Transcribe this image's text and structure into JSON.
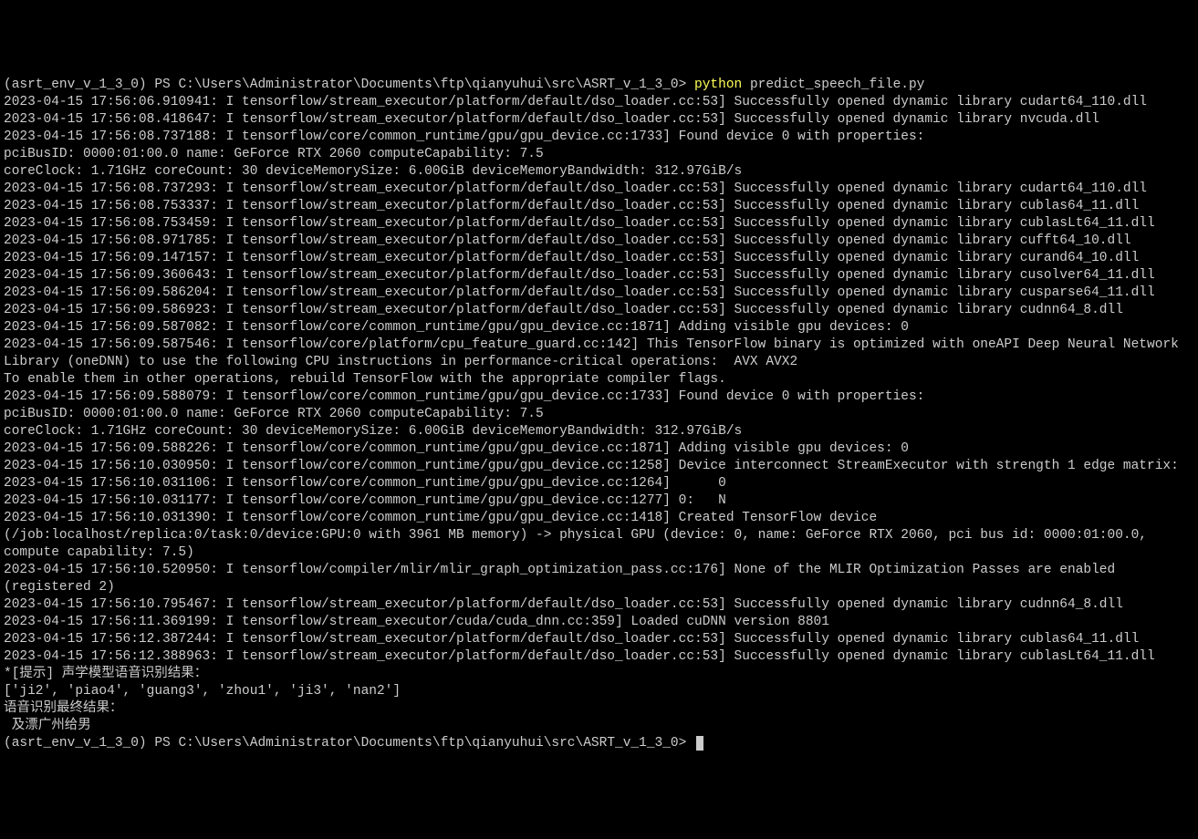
{
  "prompt1": {
    "env": "(asrt_env_v_1_3_0) ",
    "ps": "PS ",
    "path": "C:\\Users\\Administrator\\Documents\\ftp\\qianyuhui\\src\\ASRT_v_1_3_0> ",
    "cmd": "python",
    "arg": " predict_speech_file.py"
  },
  "logs": [
    "2023-04-15 17:56:06.910941: I tensorflow/stream_executor/platform/default/dso_loader.cc:53] Successfully opened dynamic library cudart64_110.dll",
    "2023-04-15 17:56:08.418647: I tensorflow/stream_executor/platform/default/dso_loader.cc:53] Successfully opened dynamic library nvcuda.dll",
    "2023-04-15 17:56:08.737188: I tensorflow/core/common_runtime/gpu/gpu_device.cc:1733] Found device 0 with properties:",
    "pciBusID: 0000:01:00.0 name: GeForce RTX 2060 computeCapability: 7.5",
    "coreClock: 1.71GHz coreCount: 30 deviceMemorySize: 6.00GiB deviceMemoryBandwidth: 312.97GiB/s",
    "2023-04-15 17:56:08.737293: I tensorflow/stream_executor/platform/default/dso_loader.cc:53] Successfully opened dynamic library cudart64_110.dll",
    "2023-04-15 17:56:08.753337: I tensorflow/stream_executor/platform/default/dso_loader.cc:53] Successfully opened dynamic library cublas64_11.dll",
    "2023-04-15 17:56:08.753459: I tensorflow/stream_executor/platform/default/dso_loader.cc:53] Successfully opened dynamic library cublasLt64_11.dll",
    "2023-04-15 17:56:08.971785: I tensorflow/stream_executor/platform/default/dso_loader.cc:53] Successfully opened dynamic library cufft64_10.dll",
    "2023-04-15 17:56:09.147157: I tensorflow/stream_executor/platform/default/dso_loader.cc:53] Successfully opened dynamic library curand64_10.dll",
    "2023-04-15 17:56:09.360643: I tensorflow/stream_executor/platform/default/dso_loader.cc:53] Successfully opened dynamic library cusolver64_11.dll",
    "2023-04-15 17:56:09.586204: I tensorflow/stream_executor/platform/default/dso_loader.cc:53] Successfully opened dynamic library cusparse64_11.dll",
    "2023-04-15 17:56:09.586923: I tensorflow/stream_executor/platform/default/dso_loader.cc:53] Successfully opened dynamic library cudnn64_8.dll",
    "2023-04-15 17:56:09.587082: I tensorflow/core/common_runtime/gpu/gpu_device.cc:1871] Adding visible gpu devices: 0",
    "2023-04-15 17:56:09.587546: I tensorflow/core/platform/cpu_feature_guard.cc:142] This TensorFlow binary is optimized with oneAPI Deep Neural Network Library (oneDNN) to use the following CPU instructions in performance-critical operations:  AVX AVX2",
    "To enable them in other operations, rebuild TensorFlow with the appropriate compiler flags.",
    "2023-04-15 17:56:09.588079: I tensorflow/core/common_runtime/gpu/gpu_device.cc:1733] Found device 0 with properties:",
    "pciBusID: 0000:01:00.0 name: GeForce RTX 2060 computeCapability: 7.5",
    "coreClock: 1.71GHz coreCount: 30 deviceMemorySize: 6.00GiB deviceMemoryBandwidth: 312.97GiB/s",
    "2023-04-15 17:56:09.588226: I tensorflow/core/common_runtime/gpu/gpu_device.cc:1871] Adding visible gpu devices: 0",
    "2023-04-15 17:56:10.030950: I tensorflow/core/common_runtime/gpu/gpu_device.cc:1258] Device interconnect StreamExecutor with strength 1 edge matrix:",
    "2023-04-15 17:56:10.031106: I tensorflow/core/common_runtime/gpu/gpu_device.cc:1264]      0",
    "2023-04-15 17:56:10.031177: I tensorflow/core/common_runtime/gpu/gpu_device.cc:1277] 0:   N",
    "2023-04-15 17:56:10.031390: I tensorflow/core/common_runtime/gpu/gpu_device.cc:1418] Created TensorFlow device (/job:localhost/replica:0/task:0/device:GPU:0 with 3961 MB memory) -> physical GPU (device: 0, name: GeForce RTX 2060, pci bus id: 0000:01:00.0, compute capability: 7.5)",
    "2023-04-15 17:56:10.520950: I tensorflow/compiler/mlir/mlir_graph_optimization_pass.cc:176] None of the MLIR Optimization Passes are enabled (registered 2)",
    "2023-04-15 17:56:10.795467: I tensorflow/stream_executor/platform/default/dso_loader.cc:53] Successfully opened dynamic library cudnn64_8.dll",
    "2023-04-15 17:56:11.369199: I tensorflow/stream_executor/cuda/cuda_dnn.cc:359] Loaded cuDNN version 8801",
    "2023-04-15 17:56:12.387244: I tensorflow/stream_executor/platform/default/dso_loader.cc:53] Successfully opened dynamic library cublas64_11.dll",
    "2023-04-15 17:56:12.388963: I tensorflow/stream_executor/platform/default/dso_loader.cc:53] Successfully opened dynamic library cublasLt64_11.dll",
    "*[提示] 声学模型语音识别结果：",
    "['ji2', 'piao4', 'guang3', 'zhou1', 'ji3', 'nan2']",
    "语音识别最终结果：",
    " 及漂广州给男"
  ],
  "prompt2": {
    "env": "(asrt_env_v_1_3_0) ",
    "ps": "PS ",
    "path": "C:\\Users\\Administrator\\Documents\\ftp\\qianyuhui\\src\\ASRT_v_1_3_0> "
  }
}
